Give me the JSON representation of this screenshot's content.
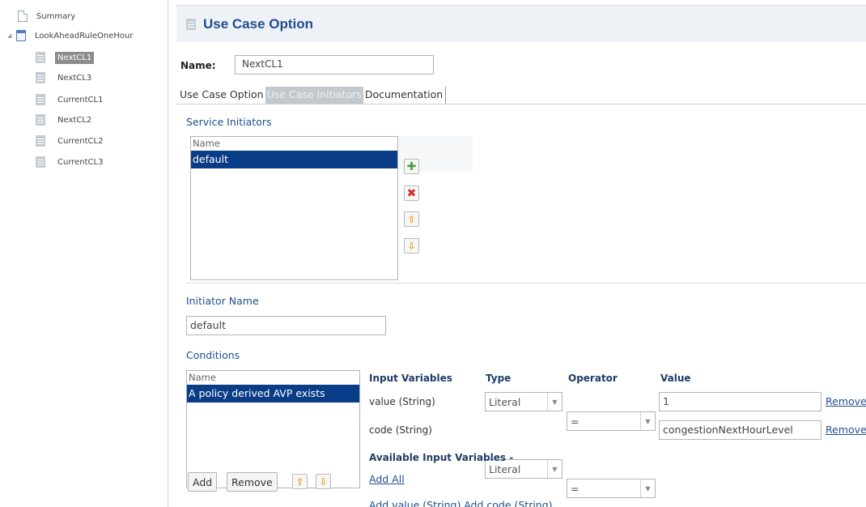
{
  "tree": {
    "root_items": [
      {
        "label": "Summary"
      },
      {
        "label": "LookAheadRuleOneHour"
      }
    ],
    "children": [
      {
        "label": "NextCL1",
        "selected": true
      },
      {
        "label": "NextCL3"
      },
      {
        "label": "CurrentCL1"
      },
      {
        "label": "NextCL2"
      },
      {
        "label": "CurrentCL2"
      },
      {
        "label": "CurrentCL3"
      }
    ]
  },
  "header": {
    "title": "Use Case Option"
  },
  "name_field": {
    "label": "Name:",
    "value": "NextCL1"
  },
  "tabs": [
    {
      "label": "Use Case Option"
    },
    {
      "label": "Use Case Initiators",
      "active": true
    },
    {
      "label": "Documentation"
    }
  ],
  "service_initiators": {
    "title": "Service Initiators",
    "column": "Name",
    "rows": [
      "default"
    ],
    "selected_index": 0
  },
  "initiator_name": {
    "title": "Initiator Name",
    "value": "default"
  },
  "conditions": {
    "title": "Conditions",
    "column": "Name",
    "rows": [
      "A policy derived AVP exists"
    ],
    "add_label": "Add",
    "remove_label": "Remove"
  },
  "variables_table": {
    "headers": {
      "input": "Input Variables",
      "type": "Type",
      "operator": "Operator",
      "value": "Value"
    },
    "rows": [
      {
        "input": "value (String)",
        "type": "Literal",
        "operator": "=",
        "value": "1",
        "action": "Remove"
      },
      {
        "input": "code (String)",
        "type": "Literal",
        "operator": "=",
        "value": "congestionNextHourLevel",
        "action": "Remove"
      }
    ],
    "available_title": "Available Input Variables -",
    "add_all": "Add All",
    "add_items": [
      "Add value (String)",
      "Add code (String)"
    ]
  },
  "colors": {
    "accent": "#1f4e8c",
    "selection": "#0a3d87",
    "header_bg": "#eef2f7"
  }
}
